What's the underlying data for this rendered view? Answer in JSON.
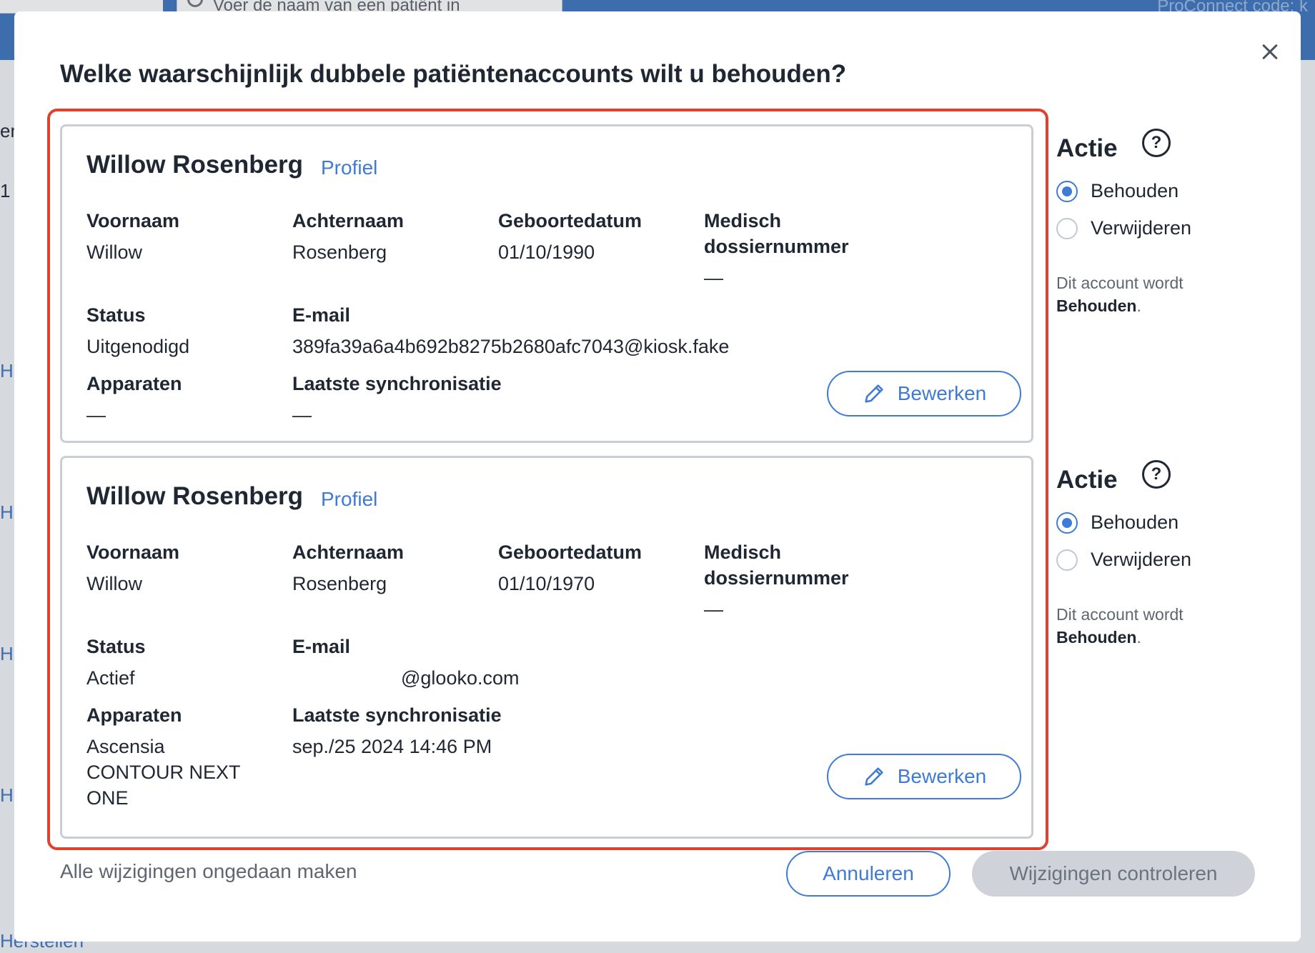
{
  "background": {
    "search_placeholder": "Voer de naam van een patiënt in",
    "brand_text": "ProConnect code: k",
    "left_fragment_top": "en",
    "left_fragment_num": "1",
    "left_links": [
      "H",
      "H",
      "H",
      "H"
    ],
    "bottom_fragment": "Herstellen"
  },
  "modal": {
    "title": "Welke waarschijnlijk dubbele patiëntenaccounts wilt u behouden?",
    "close_icon": "close-icon"
  },
  "labels": {
    "first_name": "Voornaam",
    "last_name": "Achternaam",
    "dob": "Geboortedatum",
    "mrn_line1": "Medisch",
    "mrn_line2": "dossiernummer",
    "status": "Status",
    "email": "E-mail",
    "devices": "Apparaten",
    "last_sync": "Laatste synchronisatie",
    "profile": "Profiel",
    "edit": "Bewerken",
    "action": "Actie",
    "keep": "Behouden",
    "delete": "Verwijderen",
    "note_prefix": "Dit account wordt",
    "note_suffix": "."
  },
  "patients": [
    {
      "name": "Willow Rosenberg",
      "first_name": "Willow",
      "last_name": "Rosenberg",
      "dob": "01/10/1990",
      "mrn": "—",
      "status": "Uitgenodigd",
      "email": "389fa39a6a4b692b8275b2680afc7043@kiosk.fake",
      "devices": "—",
      "last_sync": "—",
      "action_selected": "Behouden",
      "note_value": "Behouden"
    },
    {
      "name": "Willow Rosenberg",
      "first_name": "Willow",
      "last_name": "Rosenberg",
      "dob": "01/10/1970",
      "mrn": "—",
      "status": "Actief",
      "email": "@glooko.com",
      "devices_line1": "Ascensia",
      "devices_line2": "CONTOUR NEXT",
      "devices_line3": "ONE",
      "last_sync": "sep./25 2024 14:46 PM",
      "action_selected": "Behouden",
      "note_value": "Behouden"
    }
  ],
  "footer": {
    "undo": "Alle wijzigingen ongedaan maken",
    "cancel": "Annuleren",
    "review": "Wijzigingen controleren"
  },
  "colors": {
    "accent": "#3f7bd6",
    "highlight": "#e0412f",
    "disabled_button": "#cfd3d9"
  }
}
